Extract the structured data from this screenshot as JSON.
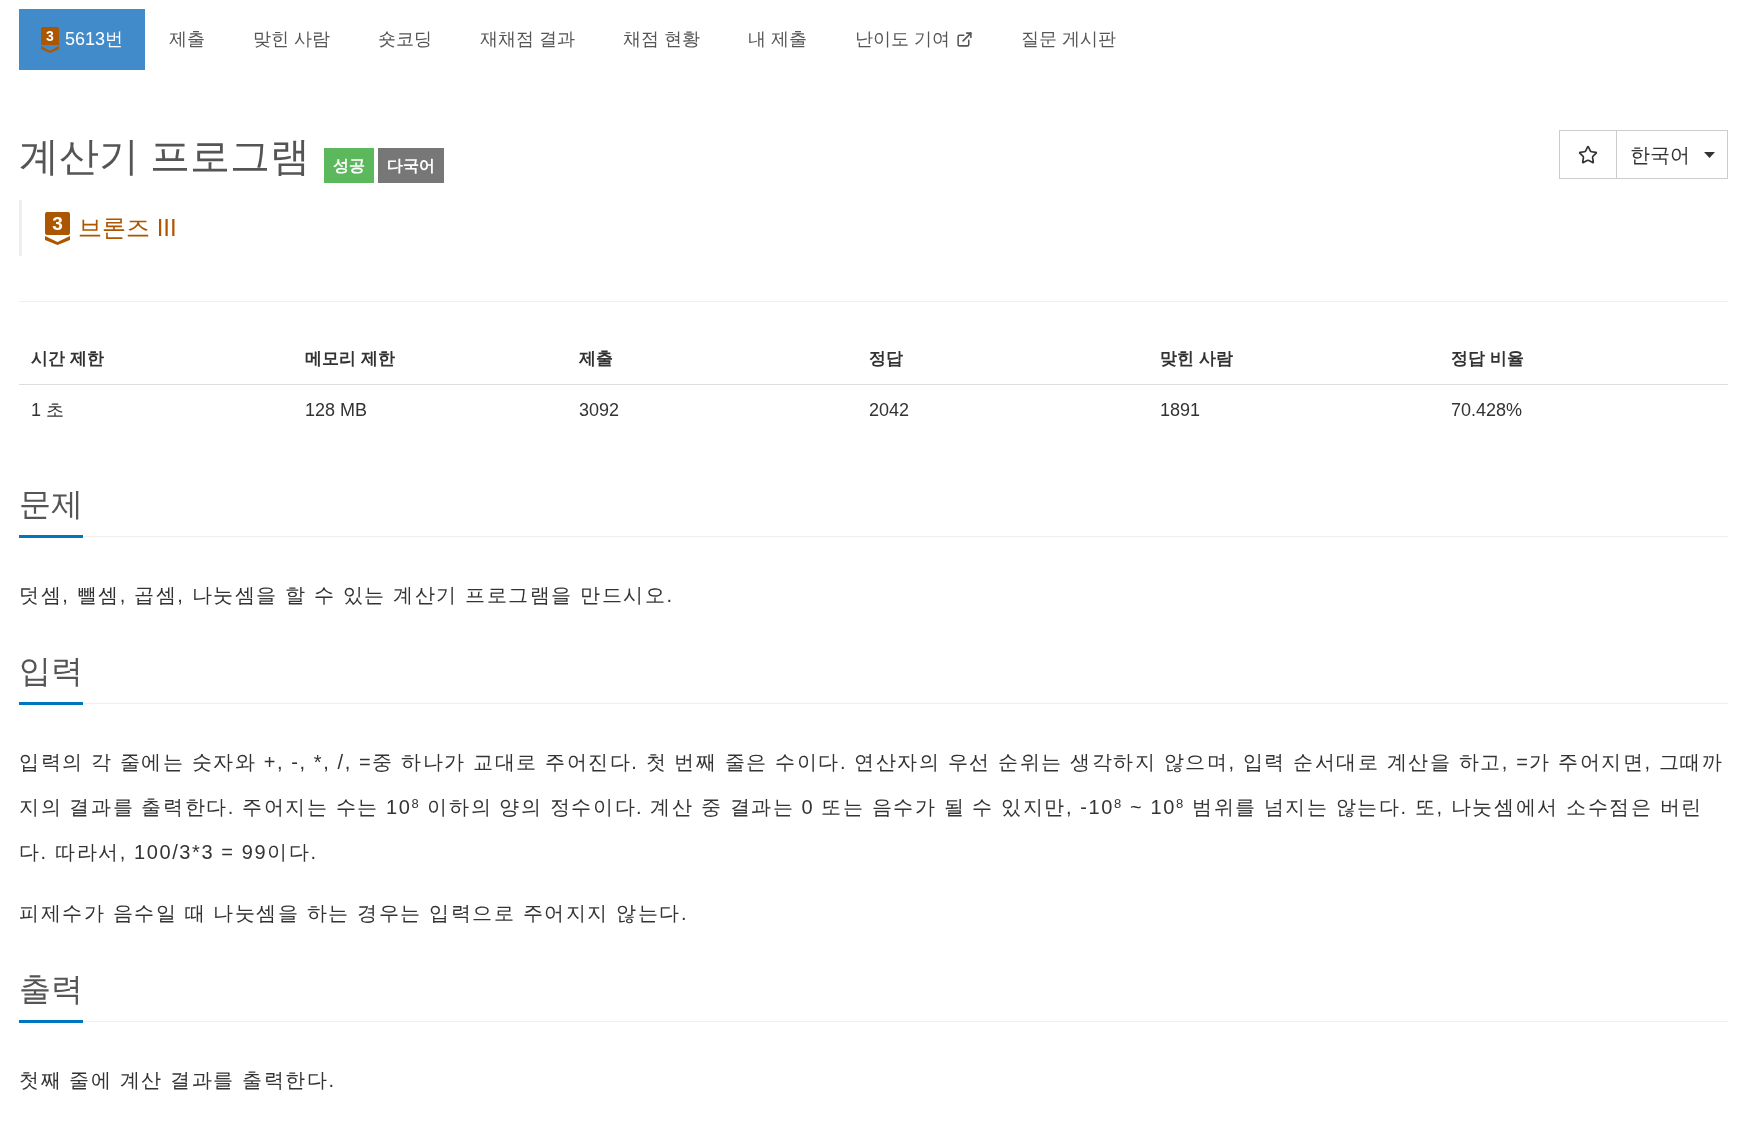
{
  "nav": {
    "tabs": [
      {
        "kind": "problem",
        "badge": "3",
        "label": "5613번",
        "selected": true
      },
      {
        "kind": "plain",
        "label": "제출",
        "selected": false
      },
      {
        "kind": "plain",
        "label": "맞힌 사람",
        "selected": false
      },
      {
        "kind": "plain",
        "label": "숏코딩",
        "selected": false
      },
      {
        "kind": "plain",
        "label": "재채점 결과",
        "selected": false
      },
      {
        "kind": "plain",
        "label": "채점 현황",
        "selected": false
      },
      {
        "kind": "plain",
        "label": "내 제출",
        "selected": false
      },
      {
        "kind": "external",
        "label": "난이도 기여",
        "selected": false
      },
      {
        "kind": "plain",
        "label": "질문 게시판",
        "selected": false
      }
    ]
  },
  "problem": {
    "title": "계산기 프로그램",
    "labels": [
      {
        "text": "성공",
        "color": "#5cb85c"
      },
      {
        "text": "다국어",
        "color": "#777777"
      }
    ],
    "tier": {
      "badge": "3",
      "name": "브론즈 III"
    }
  },
  "actions": {
    "starred": false,
    "language": "한국어"
  },
  "stats": {
    "columns": [
      "시간 제한",
      "메모리 제한",
      "제출",
      "정답",
      "맞힌 사람",
      "정답 비율"
    ],
    "rows": [
      [
        "1 초",
        "128 MB",
        "3092",
        "2042",
        "1891",
        "70.428%"
      ]
    ]
  },
  "sections": [
    {
      "heading": "문제",
      "paragraphs": [
        {
          "runs": [
            {
              "kind": "text",
              "text": "덧셈, 뺄셈, 곱셈, 나눗셈을 할 수 있는 계산기 프로그램을 만드시오."
            }
          ]
        }
      ]
    },
    {
      "heading": "입력",
      "paragraphs": [
        {
          "runs": [
            {
              "kind": "text",
              "text": "입력의 각 줄에는 숫자와 +, -, *, /, =중 하나가 교대로 주어진다. 첫 번째 줄은 수이다. 연산자의 우선 순위는 생각하지 않으며, 입력 순서대로 계산을 하고, =가 주어지면, 그때까지의 결과를 출력한다. 주어지는 수는 10"
            },
            {
              "kind": "sup",
              "text": "8"
            },
            {
              "kind": "text",
              "text": " 이하의 양의 정수이다. 계산 중 결과는 0 또는 음수가 될 수 있지만, -10"
            },
            {
              "kind": "sup",
              "text": "8"
            },
            {
              "kind": "text",
              "text": " ~ 10"
            },
            {
              "kind": "sup",
              "text": "8"
            },
            {
              "kind": "text",
              "text": " 범위를 넘지는 않는다. 또, 나눗셈에서 소수점은 버린다. 따라서, 100/3*3 = 99이다."
            }
          ]
        },
        {
          "runs": [
            {
              "kind": "text",
              "text": "피제수가 음수일 때 나눗셈을 하는 경우는 입력으로 주어지지 않는다."
            }
          ]
        }
      ]
    },
    {
      "heading": "출력",
      "paragraphs": [
        {
          "runs": [
            {
              "kind": "text",
              "text": "첫째 줄에 계산 결과를 출력한다."
            }
          ]
        }
      ]
    }
  ]
}
